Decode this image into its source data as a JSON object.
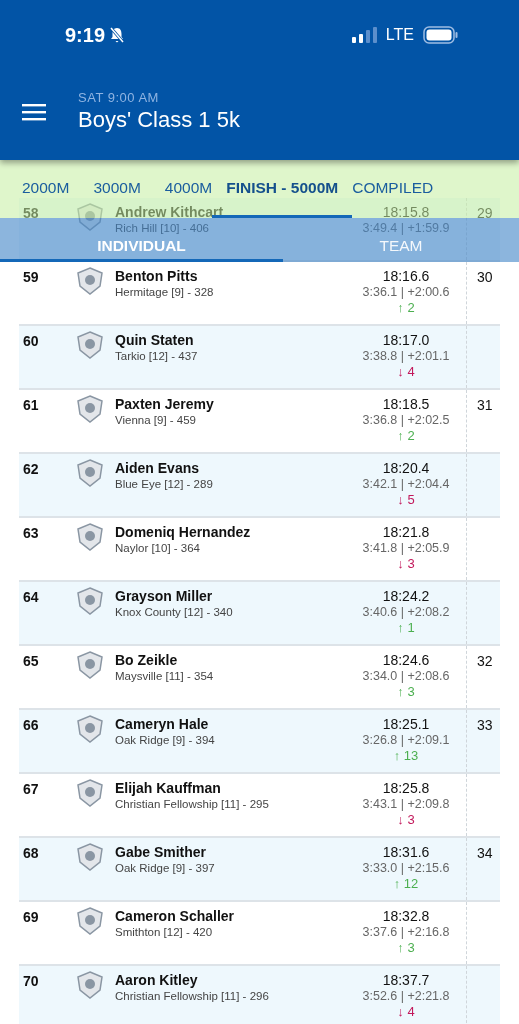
{
  "status_bar": {
    "time": "9:19",
    "network": "LTE"
  },
  "header": {
    "subtitle": "SAT 9:00 AM",
    "title": "Boys' Class 1 5k"
  },
  "split_tabs": [
    {
      "label": "2000M",
      "selected": false
    },
    {
      "label": "3000M",
      "selected": false
    },
    {
      "label": "4000M",
      "selected": false
    },
    {
      "label": "FINISH - 5000M",
      "selected": true
    },
    {
      "label": "COMPILED",
      "selected": false
    }
  ],
  "view_tabs": [
    {
      "label": "INDIVIDUAL",
      "selected": true
    },
    {
      "label": "TEAM",
      "selected": false
    }
  ],
  "results": [
    {
      "rank": "58",
      "name": "Andrew Kithcart",
      "school": "Rich Hill [10] - 406",
      "time": "18:15.8",
      "splits": "3:49.4 | +1:59.9",
      "team_place": "29"
    },
    {
      "rank": "59",
      "name": "Benton Pitts",
      "school": "Hermitage [9] - 328",
      "time": "18:16.6",
      "splits": "3:36.1 | +2:00.6",
      "change": "↑ 2",
      "color": "#4caf50",
      "team_place": "30"
    },
    {
      "rank": "60",
      "name": "Quin Staten",
      "school": "Tarkio [12] - 437",
      "time": "18:17.0",
      "splits": "3:38.8 | +2:01.1",
      "change": "↓ 4",
      "color": "#c2185b"
    },
    {
      "rank": "61",
      "name": "Paxten Jeremy",
      "school": "Vienna [9] - 459",
      "time": "18:18.5",
      "splits": "3:36.8 | +2:02.5",
      "change": "↑ 2",
      "color": "#4caf50",
      "team_place": "31"
    },
    {
      "rank": "62",
      "name": "Aiden Evans",
      "school": "Blue Eye [12] - 289",
      "time": "18:20.4",
      "splits": "3:42.1 | +2:04.4",
      "change": "↓ 5",
      "color": "#c2185b"
    },
    {
      "rank": "63",
      "name": "Domeniq Hernandez",
      "school": "Naylor [10] - 364",
      "time": "18:21.8",
      "splits": "3:41.8 | +2:05.9",
      "change": "↓ 3",
      "color": "#c2185b"
    },
    {
      "rank": "64",
      "name": "Grayson Miller",
      "school": "Knox County [12] - 340",
      "time": "18:24.2",
      "splits": "3:40.6 | +2:08.2",
      "change": "↑ 1",
      "color": "#4caf50"
    },
    {
      "rank": "65",
      "name": "Bo Zeikle",
      "school": "Maysville [11] - 354",
      "time": "18:24.6",
      "splits": "3:34.0 | +2:08.6",
      "change": "↑ 3",
      "color": "#4caf50",
      "team_place": "32"
    },
    {
      "rank": "66",
      "name": "Cameryn Hale",
      "school": "Oak Ridge [9] - 394",
      "time": "18:25.1",
      "splits": "3:26.8 | +2:09.1",
      "change": "↑ 13",
      "color": "#4caf50",
      "team_place": "33"
    },
    {
      "rank": "67",
      "name": "Elijah Kauffman",
      "school": "Christian Fellowship [11] - 295",
      "time": "18:25.8",
      "splits": "3:43.1 | +2:09.8",
      "change": "↓ 3",
      "color": "#c2185b"
    },
    {
      "rank": "68",
      "name": "Gabe Smither",
      "school": "Oak Ridge [9] - 397",
      "time": "18:31.6",
      "splits": "3:33.0 | +2:15.6",
      "change": "↑ 12",
      "color": "#4caf50",
      "team_place": "34"
    },
    {
      "rank": "69",
      "name": "Cameron Schaller",
      "school": "Smithton [12] - 420",
      "time": "18:32.8",
      "splits": "3:37.6 | +2:16.8",
      "change": "↑ 3",
      "color": "#4caf50"
    },
    {
      "rank": "70",
      "name": "Aaron Kitley",
      "school": "Christian Fellowship [11] - 296",
      "time": "18:37.7",
      "splits": "3:52.6 | +2:21.8",
      "change": "↓ 4",
      "color": "#c2185b"
    }
  ]
}
